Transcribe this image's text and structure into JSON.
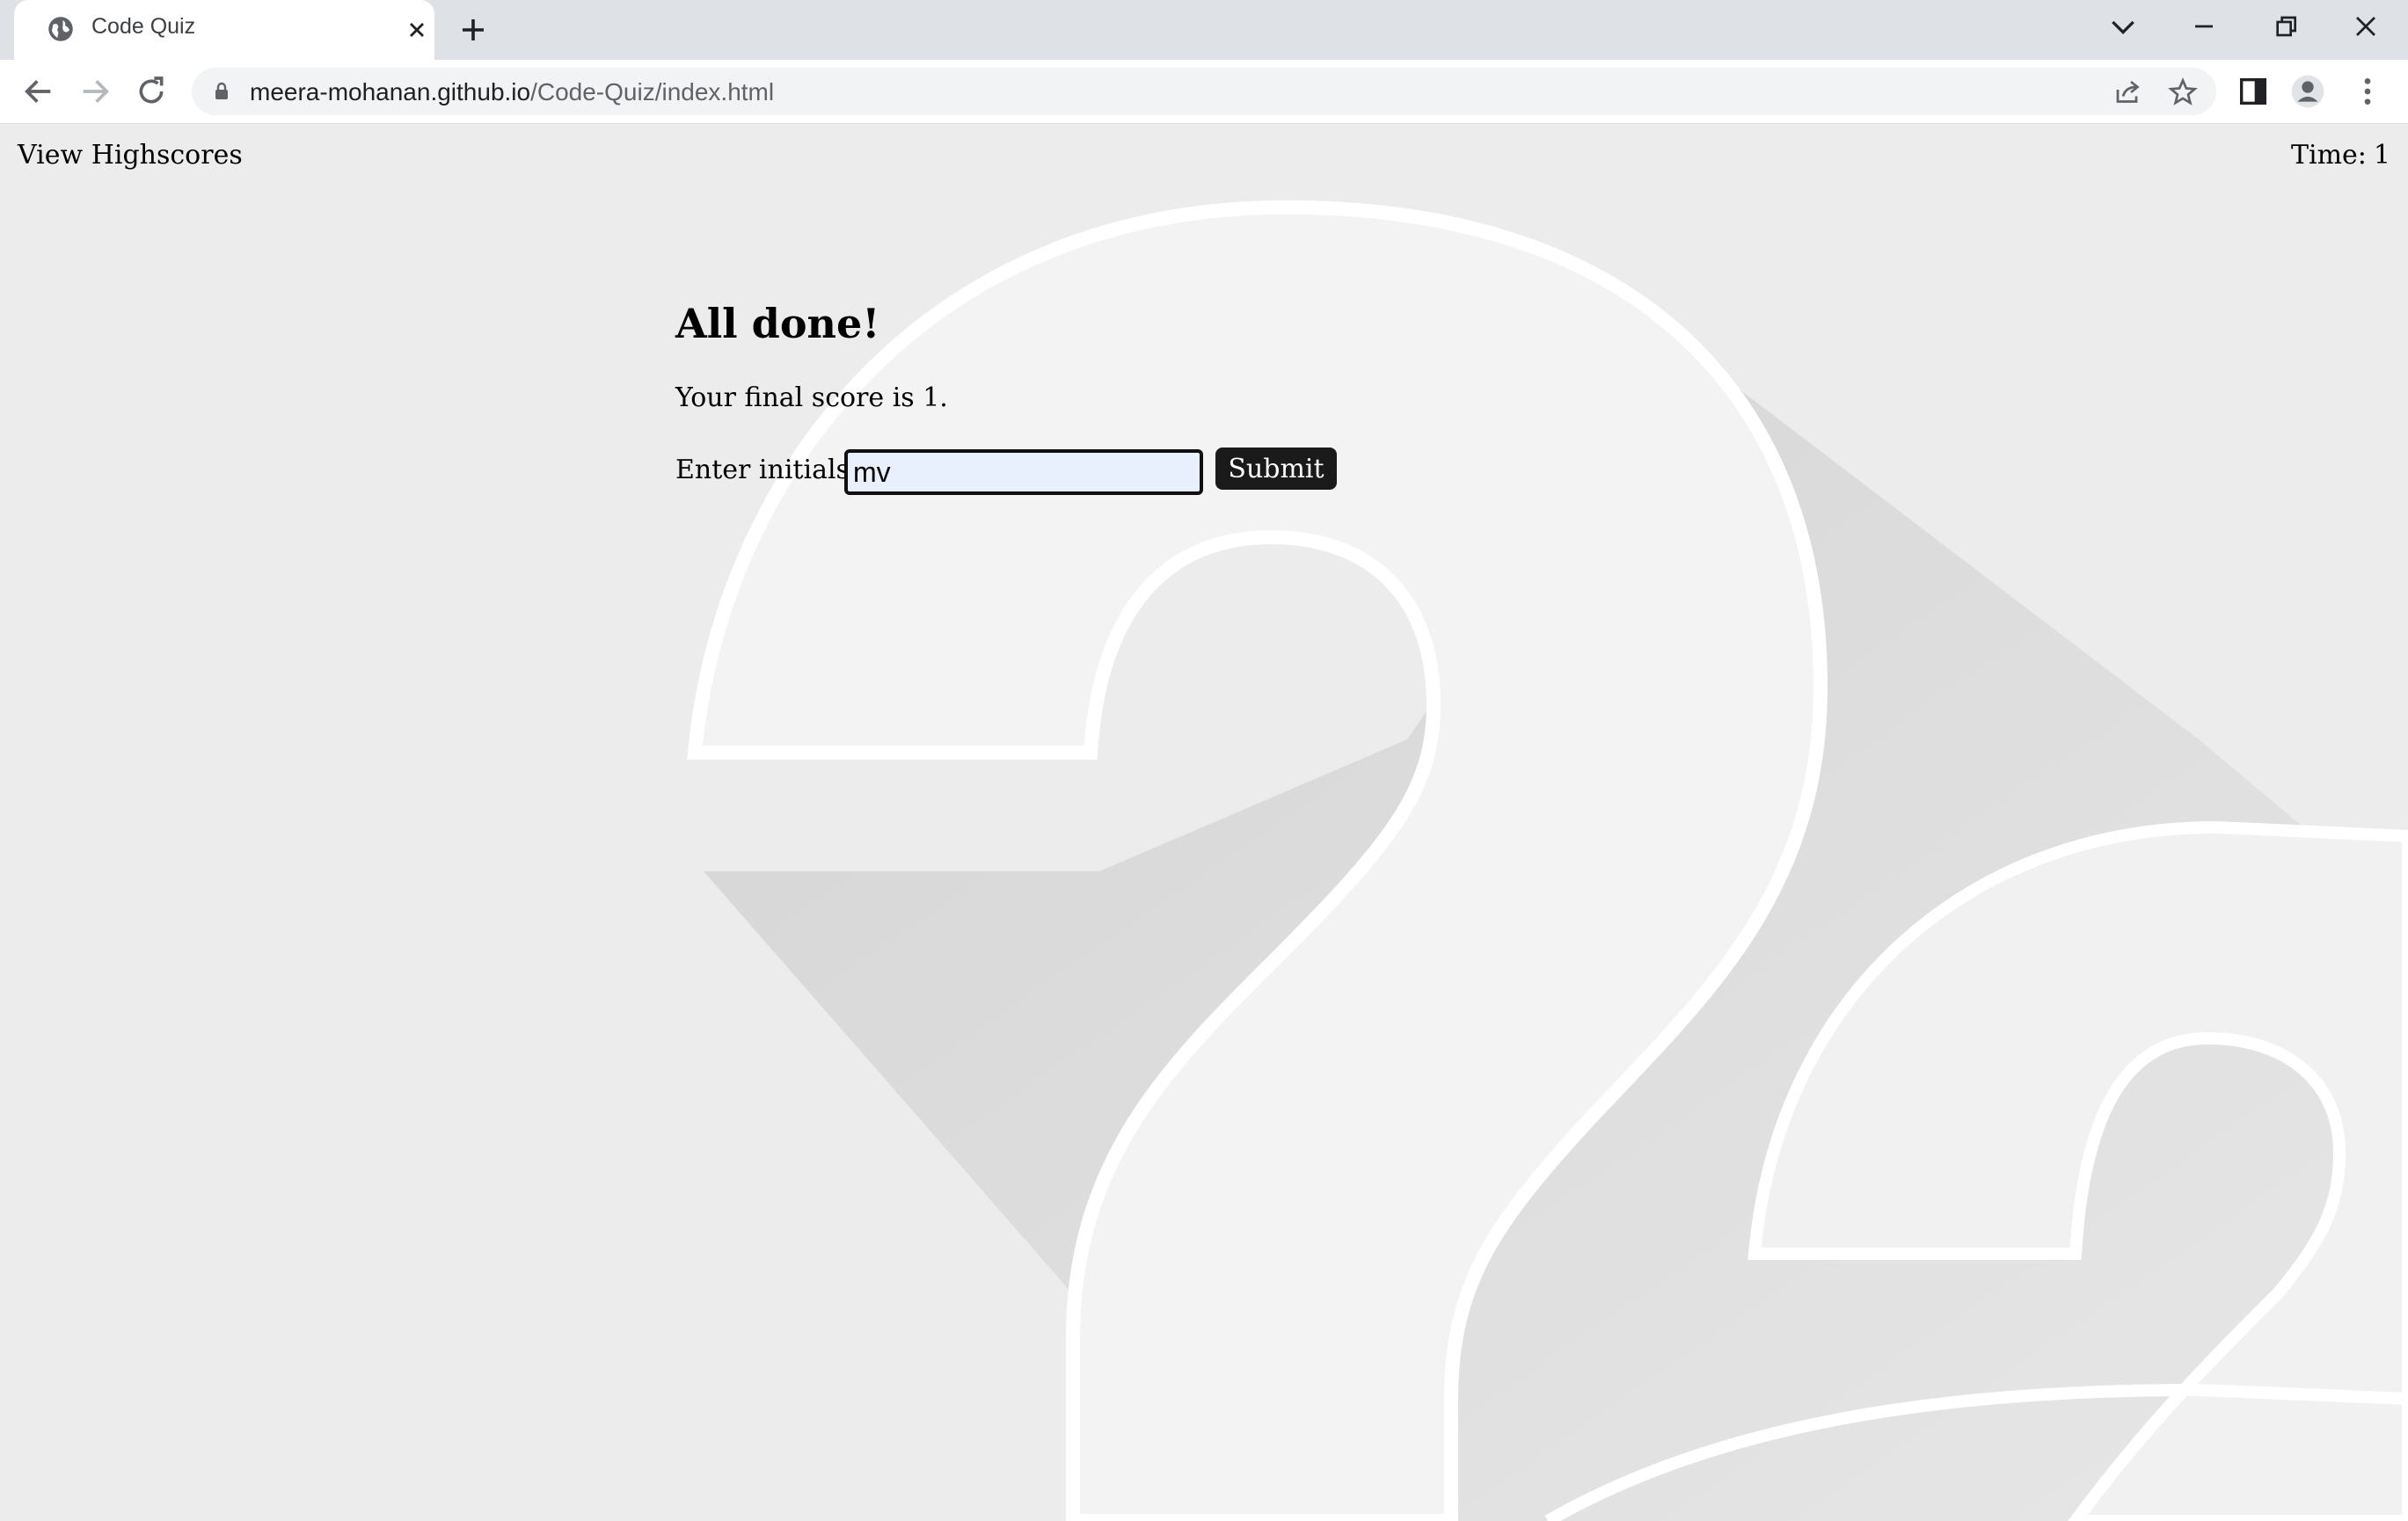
{
  "browser": {
    "tab_title": "Code Quiz",
    "url_host": "meera-mohanan.github.io",
    "url_path": "/Code-Quiz/index.html"
  },
  "page": {
    "highscores_link": "View Highscores",
    "timer_label": "Time:",
    "timer_value": "1",
    "heading": "All done!",
    "score_text": "Your final score is 1.",
    "initials_label": "Enter initials:",
    "initials_value": "mv",
    "submit_label": "Submit"
  },
  "colors": {
    "page_bg": "#ececec",
    "submit_bg": "#1a1a1a",
    "input_bg": "#e8f0fe"
  },
  "icons": {
    "favicon": "globe-icon",
    "tab_close": "close-icon",
    "new_tab": "plus-icon",
    "back": "arrow-left-icon",
    "forward": "arrow-right-icon",
    "reload": "reload-icon",
    "lock": "lock-icon",
    "share": "share-icon",
    "bookmark": "star-icon",
    "side_panel": "side-panel-icon",
    "profile": "profile-icon",
    "menu": "kebab-menu-icon"
  }
}
